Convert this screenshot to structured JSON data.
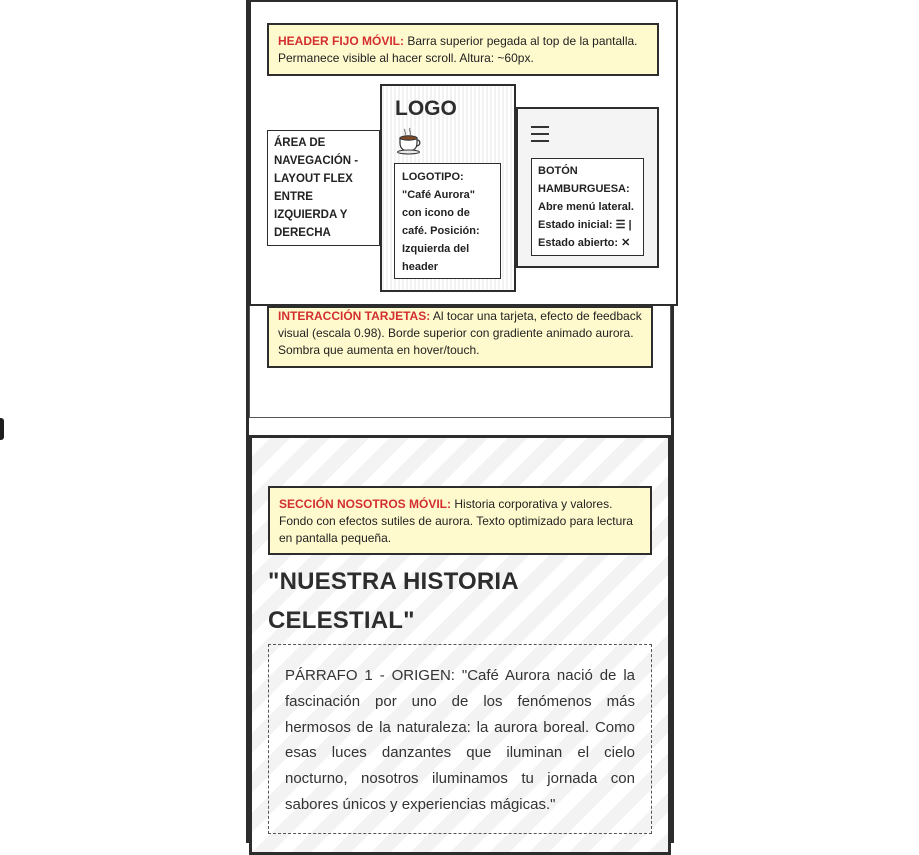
{
  "header": {
    "note_label": "HEADER FIJO MÓVIL:",
    "note_text": "Barra superior pegada al top de la pantalla. Permanece visible al hacer scroll. Altura: ~60px.",
    "nav_area": "ÁREA DE NAVEGACIÓN - LAYOUT FLEX ENTRE IZQUIERDA Y DERECHA",
    "logo_label": "LOGO",
    "logo_icon": "coffee-cup-icon",
    "logo_desc": "LOGOTIPO: \"Café Aurora\" con icono de café. Posición: Izquierda del header",
    "hamburger_icon": "hamburger-menu-icon",
    "hamburger_desc": "BOTÓN HAMBURGUESA: Abre menú lateral. Estado inicial: ☰ | Estado abierto: ✕"
  },
  "cards": {
    "note_label": "INTERACCIÓN TARJETAS:",
    "note_text": "Al tocar una tarjeta, efecto de feedback visual (escala 0.98). Borde superior con gradiente animado aurora. Sombra que aumenta en hover/touch."
  },
  "about": {
    "note_label": "SECCIÓN NOSOTROS MÓVIL:",
    "note_text": "Historia corporativa y valores. Fondo con efectos sutiles de aurora. Texto optimizado para lectura en pantalla pequeña.",
    "title": "\"NUESTRA HISTORIA CELESTIAL\"",
    "paragraph_1": "PÁRRAFO 1 - ORIGEN: \"Café Aurora nació de la fascinación por uno de los fenómenos más hermosos de la naturaleza: la aurora boreal. Como esas luces danzantes que iluminan el cielo nocturno, nosotros iluminamos tu jornada con sabores únicos y experiencias mágicas.\""
  },
  "colors": {
    "note_background": "#fffacd",
    "note_label": "#d32f2f",
    "border": "#2d2d2d"
  }
}
